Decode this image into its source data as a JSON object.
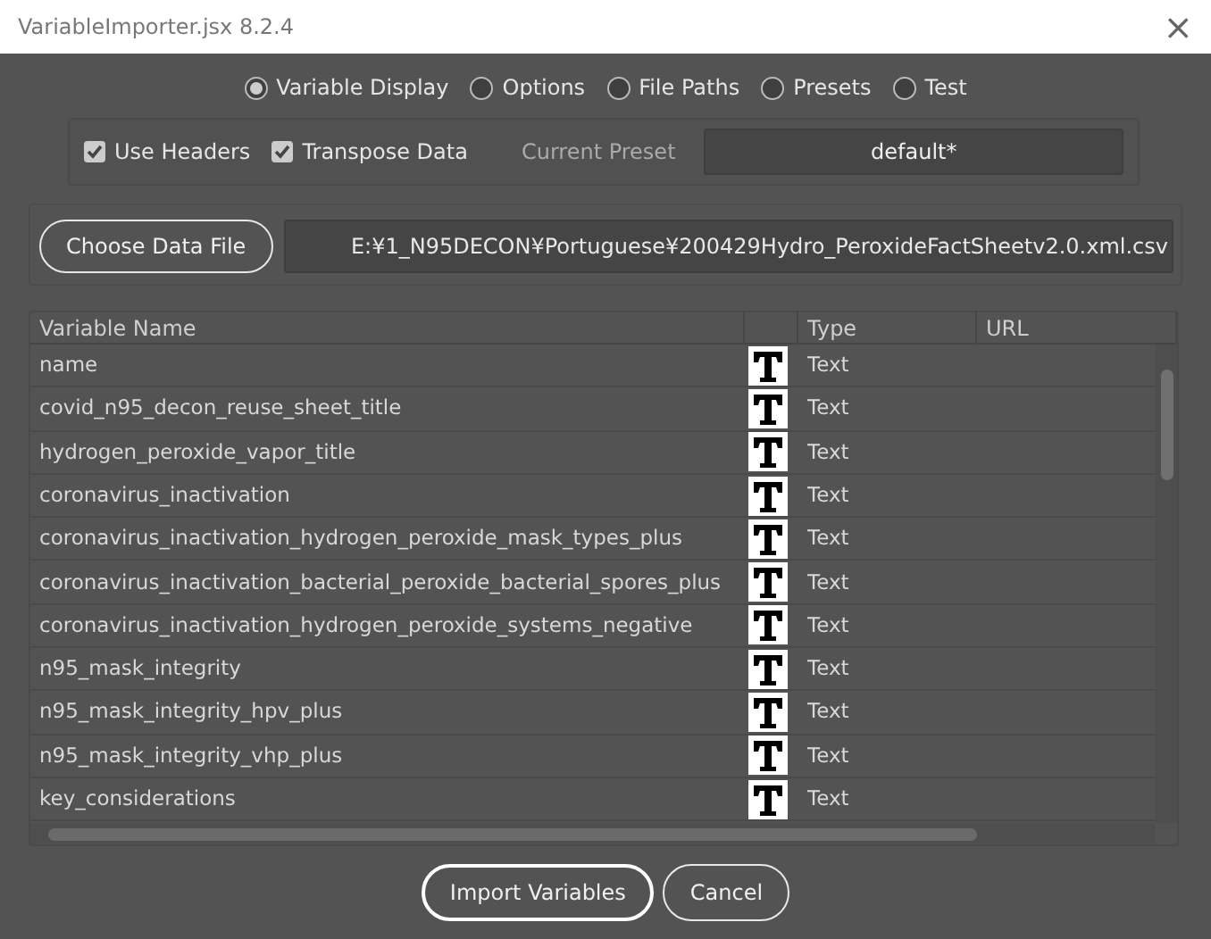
{
  "window": {
    "title": "VariableImporter.jsx 8.2.4",
    "close": "×"
  },
  "modes": [
    {
      "label": "Variable Display",
      "selected": true
    },
    {
      "label": "Options",
      "selected": false
    },
    {
      "label": "File Paths",
      "selected": false
    },
    {
      "label": "Presets",
      "selected": false
    },
    {
      "label": "Test",
      "selected": false
    }
  ],
  "options": [
    {
      "label": "Use Headers",
      "checked": true
    },
    {
      "label": "Transpose Data",
      "checked": true
    }
  ],
  "preset": {
    "label": "Current Preset",
    "value": "default*"
  },
  "data_file": {
    "button": "Choose Data File",
    "path": "E:¥1_N95DECON¥Portuguese¥200429Hydro_PeroxideFactSheetv2.0.xml.csv"
  },
  "table": {
    "columns": [
      "Variable Name",
      "Type",
      "URL"
    ],
    "rows": [
      {
        "name": "name",
        "type": "Text"
      },
      {
        "name": "covid_n95_decon_reuse_sheet_title",
        "type": "Text"
      },
      {
        "name": "hydrogen_peroxide_vapor_title",
        "type": "Text"
      },
      {
        "name": "coronavirus_inactivation",
        "type": "Text"
      },
      {
        "name": "coronavirus_inactivation_hydrogen_peroxide_mask_types_plus",
        "type": "Text"
      },
      {
        "name": "coronavirus_inactivation_bacterial_peroxide_bacterial_spores_plus",
        "type": "Text"
      },
      {
        "name": "coronavirus_inactivation_hydrogen_peroxide_systems_negative",
        "type": "Text"
      },
      {
        "name": "n95_mask_integrity",
        "type": "Text"
      },
      {
        "name": "n95_mask_integrity_hpv_plus",
        "type": "Text"
      },
      {
        "name": "n95_mask_integrity_vhp_plus",
        "type": "Text"
      },
      {
        "name": "key_considerations",
        "type": "Text"
      }
    ]
  },
  "buttons": [
    {
      "label": "Import Variables",
      "default": true
    },
    {
      "label": "Cancel",
      "default": false
    }
  ]
}
